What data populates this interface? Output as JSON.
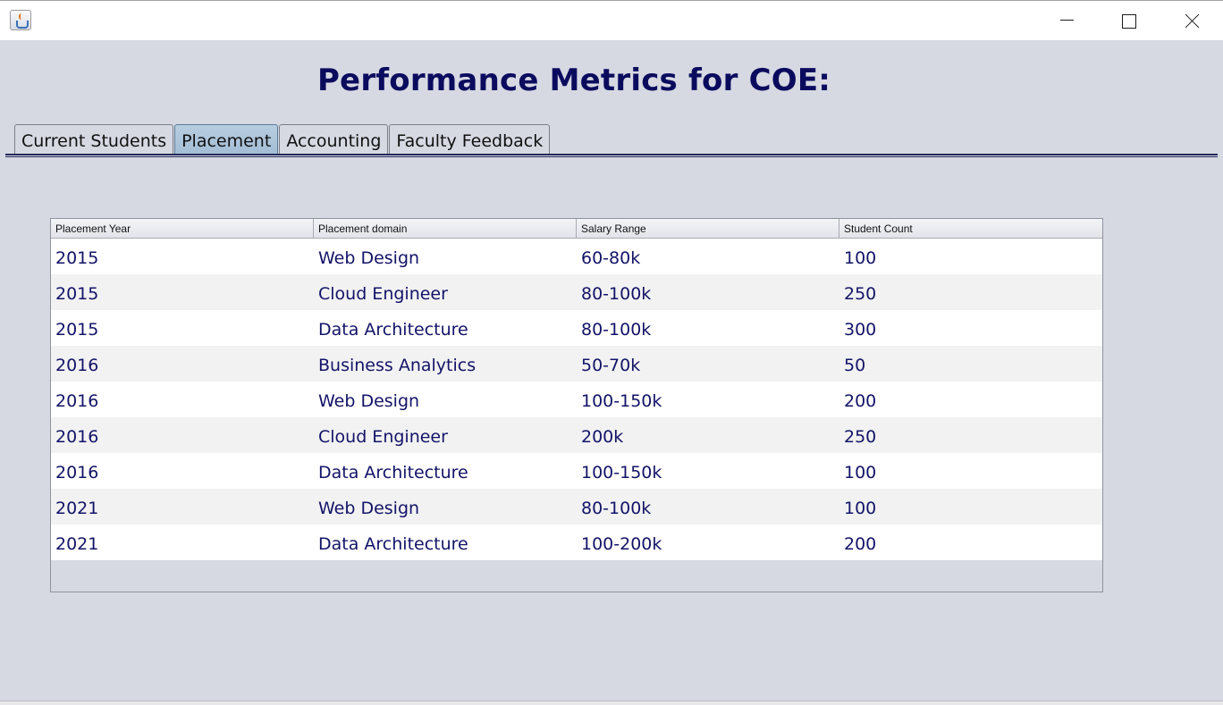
{
  "window": {
    "icon": "java-cup-icon",
    "controls": [
      "minimize",
      "maximize",
      "close"
    ]
  },
  "header": {
    "title": "Performance Metrics for COE:"
  },
  "tabs": [
    {
      "label": "Current Students",
      "active": false
    },
    {
      "label": "Placement",
      "active": true
    },
    {
      "label": "Accounting",
      "active": false
    },
    {
      "label": "Faculty Feedback",
      "active": false
    }
  ],
  "table": {
    "columns": [
      "Placement Year",
      "Placement domain",
      "Salary Range",
      "Student Count"
    ],
    "rows": [
      [
        "2015",
        "Web Design",
        "60-80k",
        "100"
      ],
      [
        "2015",
        "Cloud Engineer",
        "80-100k",
        "250"
      ],
      [
        "2015",
        "Data Architecture",
        "80-100k",
        "300"
      ],
      [
        "2016",
        "Business Analytics",
        "50-70k",
        "50"
      ],
      [
        "2016",
        "Web Design",
        "100-150k",
        "200"
      ],
      [
        "2016",
        "Cloud Engineer",
        "200k",
        "250"
      ],
      [
        "2016",
        "Data Architecture",
        "100-150k",
        "100"
      ],
      [
        "2021",
        "Web Design",
        "80-100k",
        "100"
      ],
      [
        "2021",
        "Data Architecture",
        "100-200k",
        "200"
      ]
    ]
  },
  "colors": {
    "background": "#d6d9e2",
    "title": "#0b0b5e",
    "cell_text": "#131368",
    "active_tab": "#a9c2d8"
  }
}
